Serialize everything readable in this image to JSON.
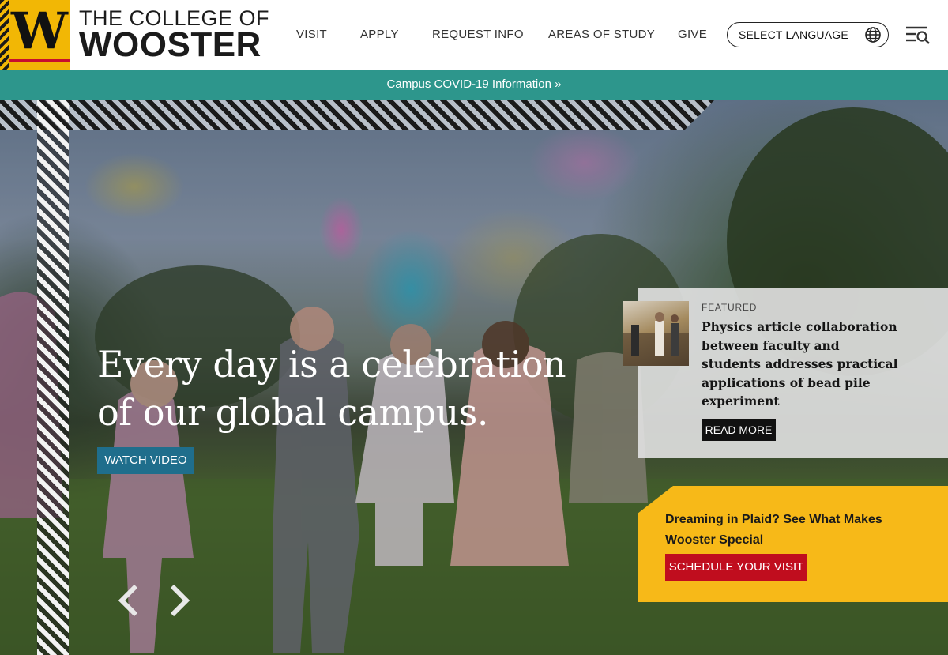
{
  "header": {
    "brand_line1": "THE COLLEGE OF",
    "brand_line2": "WOOSTER",
    "logo_letter": "W",
    "nav": [
      "VISIT",
      "APPLY",
      "REQUEST INFO",
      "AREAS OF STUDY",
      "GIVE"
    ],
    "language_label": "SELECT LANGUAGE",
    "icons": {
      "language": "globe-icon",
      "menu": "menu-search-icon"
    }
  },
  "covid_banner": "Campus COVID-19 Information »",
  "hero": {
    "headline": "Every day is a celebration of our global campus.",
    "watch_video": "WATCH VIDEO",
    "prev_icon": "chevron-left-icon",
    "next_icon": "chevron-right-icon"
  },
  "featured": {
    "label": "FEATURED",
    "title": "Physics article collaboration between faculty and students addresses practical applications of bead pile experiment",
    "read_more": "READ MORE"
  },
  "promo": {
    "title": "Dreaming in Plaid? See What Makes Wooster Special",
    "button": "SCHEDULE YOUR VISIT"
  },
  "colors": {
    "gold": "#f2b705",
    "teal_banner": "#2d968c",
    "watch_button": "#1f6e8c",
    "promo_yellow": "#f7b918",
    "schedule_red": "#c00d1e"
  }
}
